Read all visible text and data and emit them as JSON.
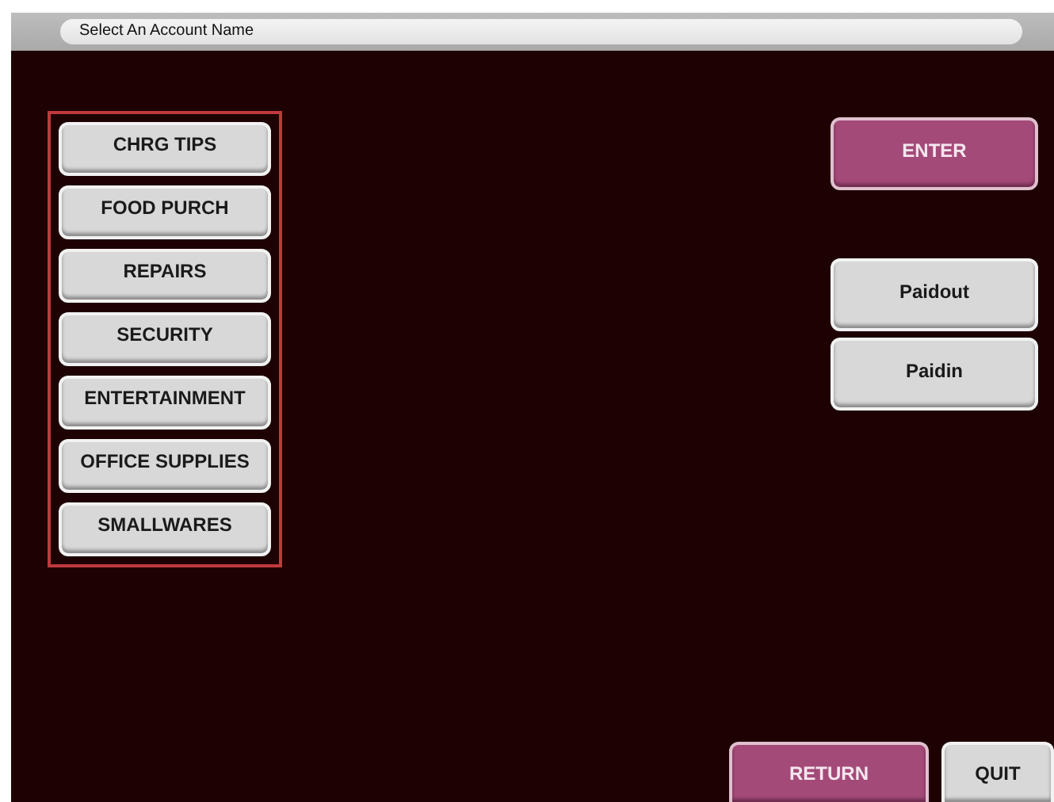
{
  "header": {
    "prompt": "Select An Account Name"
  },
  "accounts": [
    {
      "label": "CHRG TIPS"
    },
    {
      "label": "FOOD PURCH"
    },
    {
      "label": "REPAIRS"
    },
    {
      "label": "SECURITY"
    },
    {
      "label": "ENTERTAINMENT"
    },
    {
      "label": "OFFICE SUPPLIES"
    },
    {
      "label": "SMALLWARES"
    }
  ],
  "actions": [
    {
      "label": "ENTER",
      "kind": "accent"
    },
    {
      "label": "Paidout",
      "kind": "plain"
    },
    {
      "label": "Paidin",
      "kind": "plain"
    }
  ],
  "footer_buttons": [
    {
      "label": "RETURN",
      "kind": "accent"
    },
    {
      "label": "QUIT",
      "kind": "plain"
    }
  ]
}
